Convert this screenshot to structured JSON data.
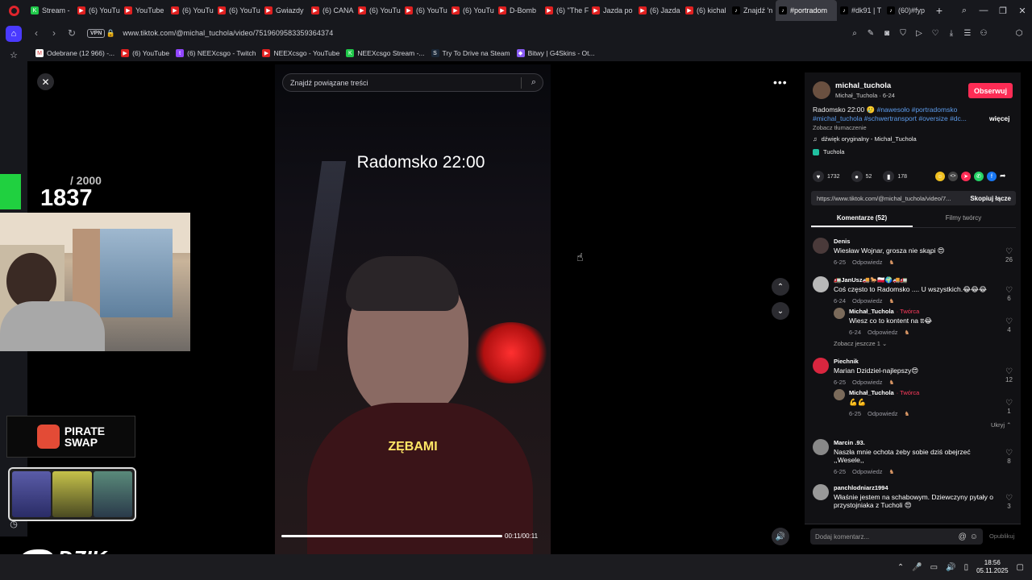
{
  "tabs": [
    {
      "label": "Stream -",
      "fav": "#20c94a",
      "icon": "K"
    },
    {
      "label": "(6) YouTu",
      "fav": "#e02020",
      "icon": "▶"
    },
    {
      "label": "YouTube",
      "fav": "#e02020",
      "icon": "▶"
    },
    {
      "label": "(6) YouTu",
      "fav": "#e02020",
      "icon": "▶"
    },
    {
      "label": "(6) YouTu",
      "fav": "#e02020",
      "icon": "▶"
    },
    {
      "label": "Gwiazdy",
      "fav": "#e02020",
      "icon": "▶"
    },
    {
      "label": "(6) CANA",
      "fav": "#e02020",
      "icon": "▶"
    },
    {
      "label": "(6) YouTu",
      "fav": "#e02020",
      "icon": "▶"
    },
    {
      "label": "(6) YouTu",
      "fav": "#e02020",
      "icon": "▶"
    },
    {
      "label": "(6) YouTu",
      "fav": "#e02020",
      "icon": "▶"
    },
    {
      "label": "D-Bomb",
      "fav": "#e02020",
      "icon": "▶"
    },
    {
      "label": "(6) \"The F",
      "fav": "#e02020",
      "icon": "▶"
    },
    {
      "label": "Jazda po",
      "fav": "#e02020",
      "icon": "▶"
    },
    {
      "label": "(6) Jazda",
      "fav": "#e02020",
      "icon": "▶"
    },
    {
      "label": "(6) kichal",
      "fav": "#e02020",
      "icon": "▶"
    },
    {
      "label": "Znajdź 'n",
      "fav": "#000000",
      "icon": "♪"
    },
    {
      "label": "#portradom",
      "fav": "#000000",
      "icon": "♪"
    },
    {
      "label": "#dk91 | T",
      "fav": "#000000",
      "icon": "♪"
    },
    {
      "label": "(60)#fyp",
      "fav": "#000000",
      "icon": "♪"
    }
  ],
  "address": {
    "vpn": "VPN",
    "url": "www.tiktok.com/@michal_tuchola/video/7519609583359364374"
  },
  "bookmarks": [
    {
      "label": "Odebrane (12 966) -...",
      "fav": "#ffffff",
      "icon": "M"
    },
    {
      "label": "(6) YouTube",
      "fav": "#e02020",
      "icon": "▶"
    },
    {
      "label": "(6) NEEXcsgo - Twitch",
      "fav": "#9146ff",
      "icon": "t"
    },
    {
      "label": "NEEXcsgo - YouTube",
      "fav": "#e02020",
      "icon": "▶"
    },
    {
      "label": "NEEXcsgo Stream -...",
      "fav": "#20c94a",
      "icon": "K"
    },
    {
      "label": "Try To Drive na Steam",
      "fav": "#1b2838",
      "icon": "S"
    },
    {
      "label": "Bitwy | G4Skins - Ot...",
      "fav": "#8a5cf5",
      "icon": "◆"
    }
  ],
  "video": {
    "search_placeholder": "Znajdź powiązane treści",
    "title": "Radomsko 22:00",
    "caption": "ZĘBAMI",
    "time": "00:11/00:11",
    "progress": 1.0
  },
  "overlay": {
    "count_current": "1837",
    "count_max": "/ 2000",
    "pirate_line1": "PIRATE",
    "pirate_line2": "SWAP",
    "dzik": "DZIK"
  },
  "creator": {
    "username": "michal_tuchola",
    "subline": "Michał_Tuchola · 6-24",
    "follow": "Obserwuj",
    "desc_plain": "Radomsko 22:00 🥲",
    "desc_tags": "#nawesoło #portradomsko #michal_tuchola #schwertransport #oversize #dc...",
    "more": "więcej",
    "translate": "Zobacz tłumaczenie",
    "sound": "dźwięk oryginalny - Michał_Tuchola",
    "location": "Tuchola",
    "likes": "1732",
    "comments": "52",
    "saves": "178",
    "link": "https://www.tiktok.com/@michal_tuchola/video/7...",
    "copy": "Skopiuj łącze",
    "tab_comments": "Komentarze (52)",
    "tab_videos": "Filmy twórcy"
  },
  "comments": [
    {
      "name": "Denis",
      "text": "Wiesław Wojnar, grosza nie skąpi 😍",
      "date": "6-25",
      "reply": "Odpowiedz",
      "likes": "26",
      "avatar": "#4a3a3a"
    },
    {
      "name": "🚛JanUsz🚚🐎🇵🇱🌍🚚🚛",
      "text": "Coś często to Radomsko .... U wszystkich.😂😂😂",
      "date": "6-24",
      "reply": "Odpowiedz",
      "likes": "6",
      "avatar": "#b8b8b8"
    },
    {
      "name": "Michał_Tuchola",
      "creator": "· Twórca",
      "text": "Wiesz co to kontent na tt😂",
      "date": "6-24",
      "reply": "Odpowiedz",
      "likes": "4",
      "avatar": "#7a6a5a"
    },
    {
      "name": "Piechnik",
      "text": "Marian Dzidziel-najlepszy😍",
      "date": "6-25",
      "reply": "Odpowiedz",
      "likes": "12",
      "avatar": "#d9263f"
    },
    {
      "name": "Michał_Tuchola",
      "creator": "· Twórca",
      "text": "💪💪",
      "date": "6-25",
      "reply": "Odpowiedz",
      "likes": "1",
      "avatar": "#7a6a5a"
    },
    {
      "name": "Marcin .93.",
      "text": "Naszła mnie ochota żeby sobie dziś obejrzeć ,,Wesele,,",
      "date": "6-25",
      "reply": "Odpowiedz",
      "likes": "8",
      "avatar": "#888888"
    },
    {
      "name": "panchlodniarz1994",
      "text": "Właśnie jestem na schabowym. Dziewczyny pytały o przystojniaka z Tucholi 😍",
      "date": "",
      "reply": "",
      "likes": "3",
      "avatar": "#999999"
    }
  ],
  "see_more": "Zobacz jeszcze 1 ⌄",
  "hide": "Ukryj ⌃",
  "add_comment": {
    "placeholder": "Dodaj komentarz...",
    "publish": "Opublikuj"
  },
  "clock": {
    "time": "18:56",
    "date": "05.11.2025"
  }
}
